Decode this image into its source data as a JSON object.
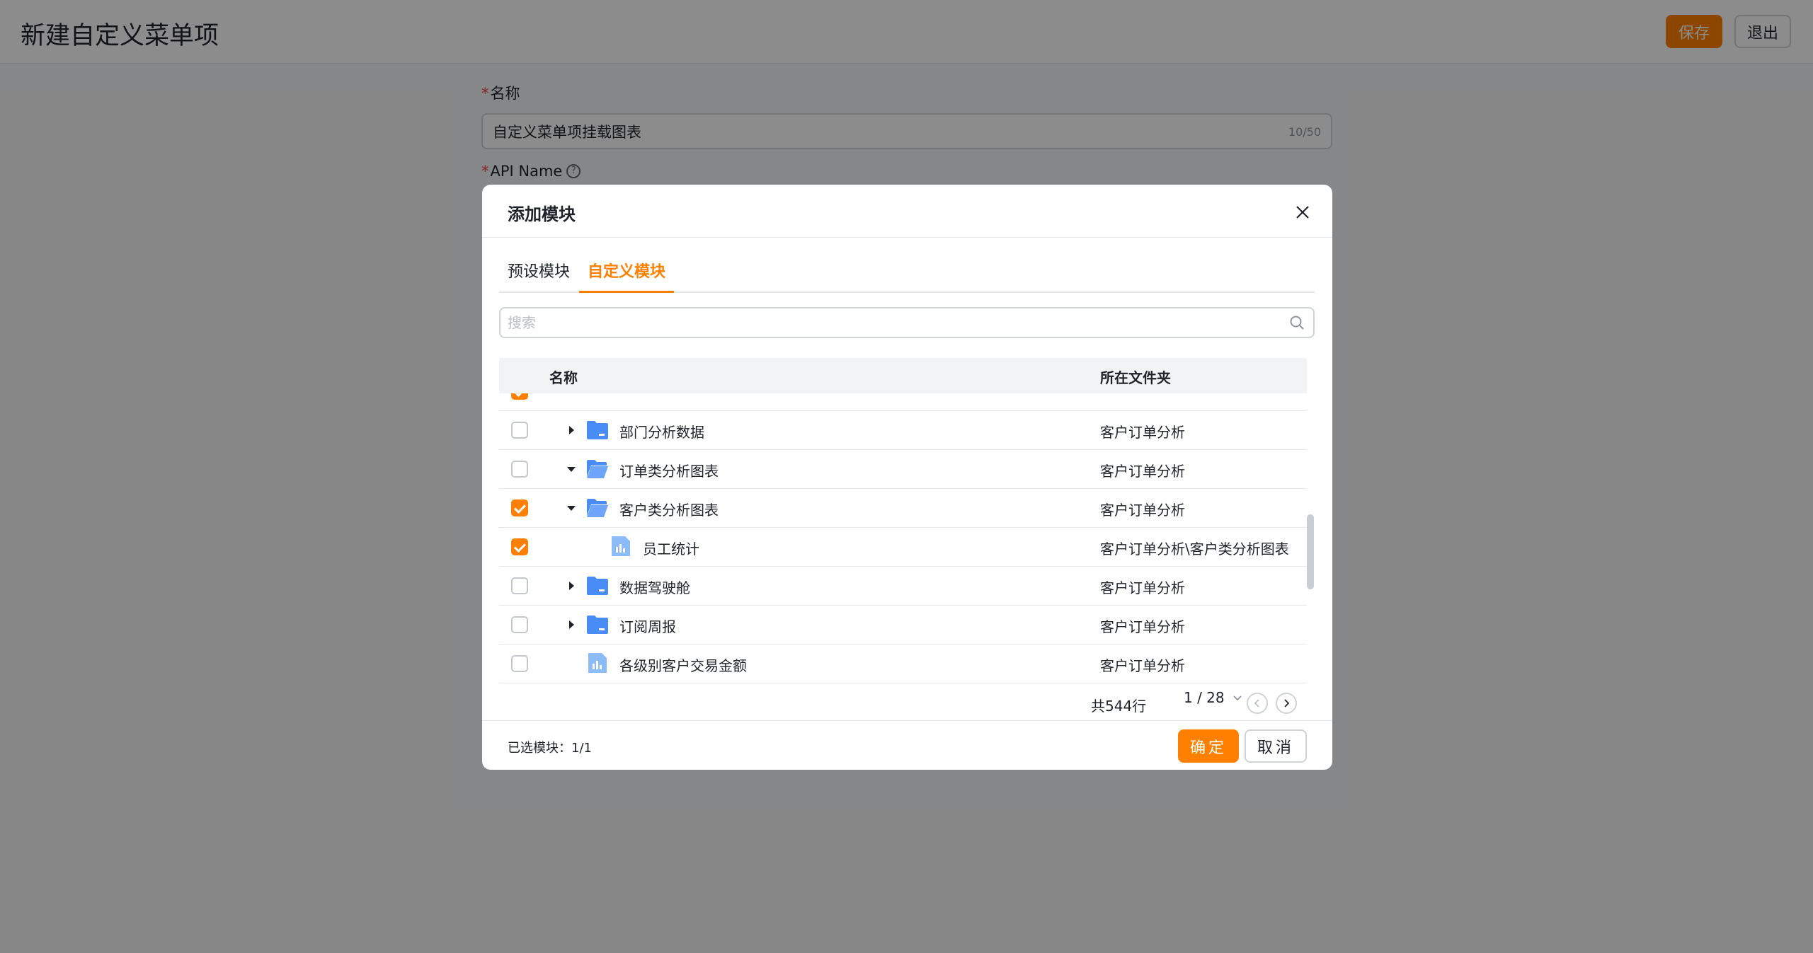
{
  "page": {
    "title": "新建自定义菜单项",
    "save_label": "保存",
    "exit_label": "退出"
  },
  "form": {
    "name_label": "名称",
    "name_value": "自定义菜单项挂载图表",
    "name_count": "10/50",
    "api_label": "API Name",
    "required_mark": "*",
    "help_glyph": "?"
  },
  "modal": {
    "title": "添加模块",
    "tabs": [
      {
        "label": "预设模块",
        "active": false
      },
      {
        "label": "自定义模块",
        "active": true
      }
    ],
    "search_placeholder": "搜索",
    "columns": {
      "name": "名称",
      "folder": "所在文件夹"
    },
    "rows": [
      {
        "name": "部门分析数据",
        "folder": "客户订单分析",
        "type": "folder",
        "expanded": false,
        "checked": false,
        "level": 1
      },
      {
        "name": "订单类分析图表",
        "folder": "客户订单分析",
        "type": "folder",
        "expanded": true,
        "checked": false,
        "level": 1
      },
      {
        "name": "客户类分析图表",
        "folder": "客户订单分析",
        "type": "folder",
        "expanded": true,
        "checked": true,
        "level": 1
      },
      {
        "name": "员工统计",
        "folder": "客户订单分析\\客户类分析图表",
        "type": "chart",
        "checked": true,
        "level": 2
      },
      {
        "name": "数据驾驶舱",
        "folder": "客户订单分析",
        "type": "folder",
        "expanded": false,
        "checked": false,
        "level": 1
      },
      {
        "name": "订阅周报",
        "folder": "客户订单分析",
        "type": "folder",
        "expanded": false,
        "checked": false,
        "level": 1
      },
      {
        "name": "各级别客户交易金额",
        "folder": "客户订单分析",
        "type": "chart",
        "checked": false,
        "level": 1
      }
    ],
    "pagination": {
      "total": "共544行",
      "page": "1 / 28"
    },
    "selected_count": "已选模块：1/1",
    "ok_label": "确定",
    "cancel_label": "取消"
  },
  "colors": {
    "accent": "#ff8000",
    "folder": "#4a8cf7",
    "chart": "#8cbcf7"
  }
}
